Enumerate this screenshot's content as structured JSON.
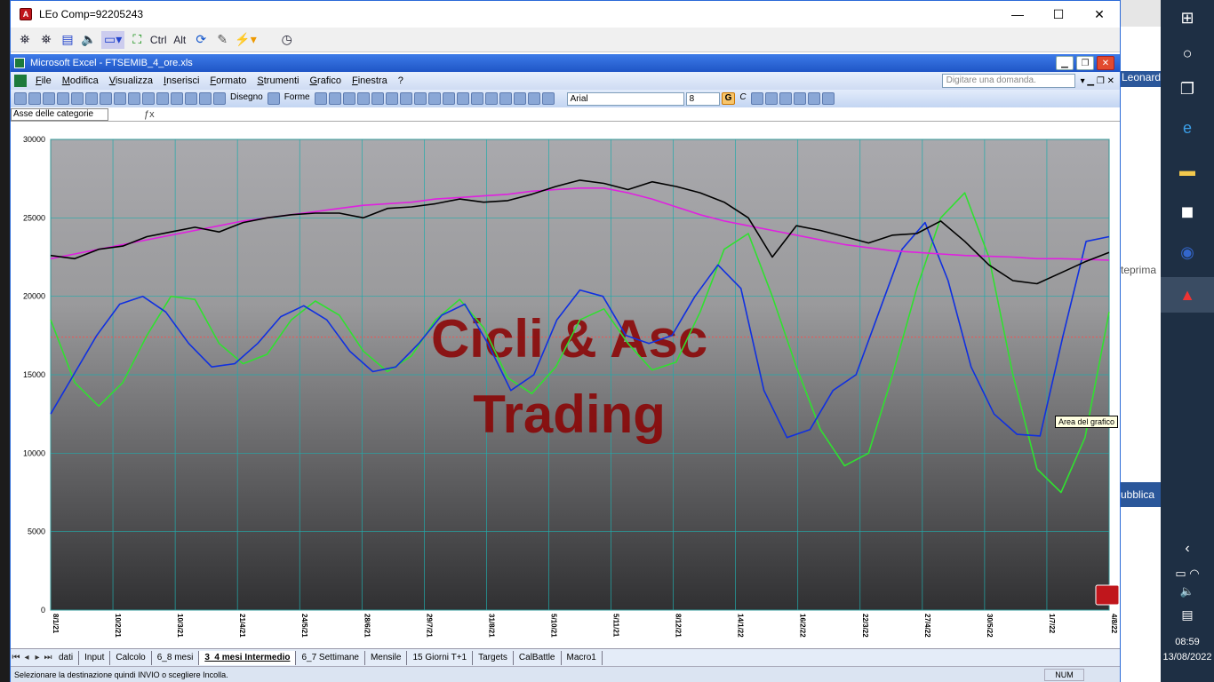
{
  "window": {
    "title": "LEo Comp=92205243",
    "minimize": "—",
    "maximize": "☐",
    "close": "✕"
  },
  "outer_toolbar": {
    "ctrl": "Ctrl",
    "alt": "Alt"
  },
  "excel": {
    "title": "Microsoft Excel - FTSEMIB_4_ore.xls",
    "menu": [
      "File",
      "Modifica",
      "Visualizza",
      "Inserisci",
      "Formato",
      "Strumenti",
      "Grafico",
      "Finestra",
      "?"
    ],
    "ask_placeholder": "Digitare una domanda.",
    "toolbar": {
      "draw_label": "Disegno",
      "shapes_label": "Forme",
      "font": "Arial",
      "size": "8",
      "bold": "G",
      "italic": "C"
    },
    "name_box": "Asse delle categorie",
    "tooltip": "Area del grafico",
    "sheet_tabs": [
      "dati",
      "Input",
      "Calcolo",
      "6_8 mesi",
      "3_4 mesi Intermedio",
      "6_7 Settimane",
      "Mensile",
      "15 Giorni T+1",
      "Targets",
      "CalBattle",
      "Macro1"
    ],
    "active_tab": "3_4 mesi Intermedio",
    "status_text": "Selezionare la destinazione quindi INVIO o scegliere Incolla.",
    "status_num": "NUM"
  },
  "chart_data": {
    "type": "line",
    "ylim": [
      0,
      30000
    ],
    "yticks": [
      0,
      5000,
      10000,
      15000,
      20000,
      25000,
      30000
    ],
    "xticks": [
      "8/1/21",
      "10/2/21",
      "10/3/21",
      "21/4/21",
      "24/5/21",
      "28/6/21",
      "29/7/21",
      "31/8/21",
      "5/10/21",
      "5/11/21",
      "8/12/21",
      "14/1/22",
      "16/2/22",
      "22/3/22",
      "27/4/22",
      "30/5/22",
      "1/7/22",
      "4/8/22"
    ],
    "watermark": [
      "Cicli & Asc",
      "Trading"
    ],
    "reference_line": 17400,
    "series": [
      {
        "color": "#000000",
        "values": [
          22600,
          22400,
          23000,
          23200,
          23800,
          24100,
          24400,
          24100,
          24700,
          25000,
          25200,
          25300,
          25300,
          25000,
          25600,
          25700,
          25900,
          26200,
          26000,
          26100,
          26500,
          27000,
          27400,
          27200,
          26800,
          27300,
          27000,
          26600,
          26000,
          25000,
          22500,
          24500,
          24200,
          23800,
          23400,
          23900,
          24000,
          24800,
          23500,
          22000,
          21000,
          20800,
          21500,
          22200,
          22800
        ]
      },
      {
        "color": "#e020e0",
        "values": [
          22400,
          22700,
          23000,
          23300,
          23600,
          23900,
          24200,
          24500,
          24800,
          25000,
          25200,
          25400,
          25600,
          25800,
          25900,
          26000,
          26200,
          26300,
          26400,
          26500,
          26700,
          26800,
          26900,
          26900,
          26600,
          26200,
          25700,
          25200,
          24800,
          24500,
          24200,
          23900,
          23600,
          23300,
          23100,
          22900,
          22800,
          22700,
          22600,
          22550,
          22500,
          22400,
          22400,
          22350,
          22300
        ]
      },
      {
        "color": "#30e030",
        "values": [
          18500,
          14500,
          13000,
          14500,
          17500,
          20000,
          19800,
          17000,
          15700,
          16300,
          18500,
          19700,
          18800,
          16500,
          15200,
          16200,
          18500,
          19800,
          18000,
          14800,
          13800,
          15500,
          18500,
          19200,
          17000,
          15300,
          15800,
          19000,
          23000,
          24000,
          20000,
          15500,
          11500,
          9200,
          10000,
          15000,
          20500,
          25000,
          26600,
          22500,
          15000,
          9000,
          7500,
          11000,
          19000
        ]
      },
      {
        "color": "#1030e0",
        "values": [
          12500,
          15000,
          17500,
          19500,
          20000,
          19000,
          17000,
          15500,
          15700,
          17000,
          18700,
          19400,
          18500,
          16500,
          15200,
          15500,
          17000,
          18800,
          19500,
          17000,
          14000,
          15000,
          18500,
          20400,
          20000,
          17500,
          17000,
          17500,
          20000,
          22000,
          20500,
          14000,
          11000,
          11500,
          14000,
          15000,
          19000,
          23000,
          24700,
          21000,
          15500,
          12500,
          11200,
          11100,
          17500,
          23500,
          23800
        ]
      }
    ]
  },
  "taskbar": {
    "time": "08:59",
    "date": "13/08/2022"
  },
  "behind": {
    "text1": "Leonardo",
    "text2": "teprima",
    "text3": "ubblica"
  }
}
